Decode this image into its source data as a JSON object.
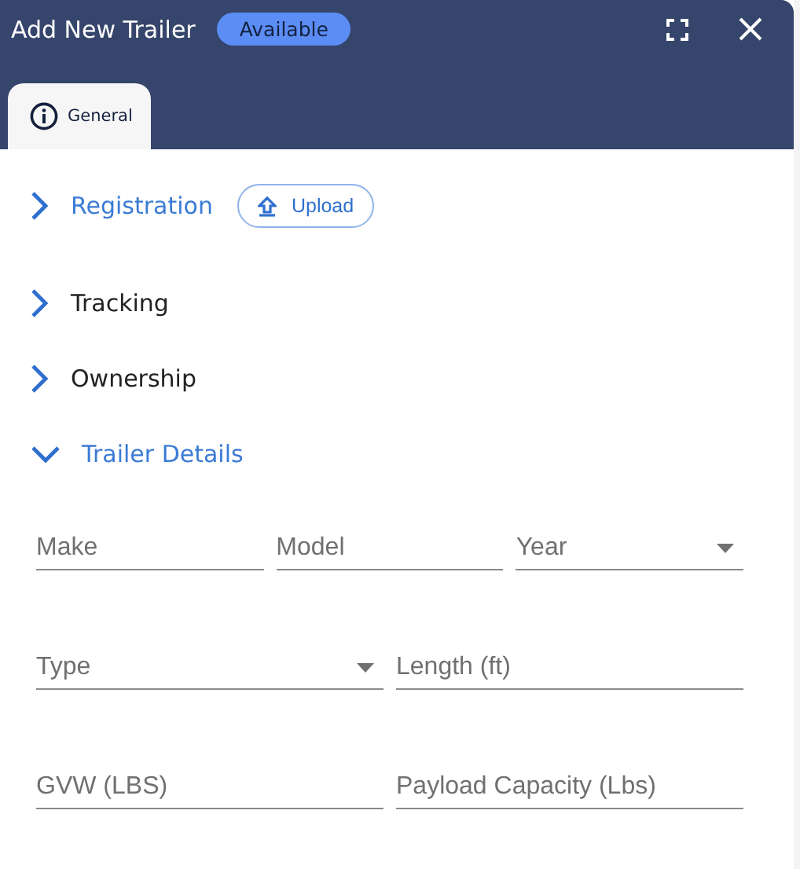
{
  "header": {
    "title": "Add New Trailer",
    "status": "Available"
  },
  "tabs": [
    {
      "label": "General",
      "selected": true
    }
  ],
  "sections": [
    {
      "title": "Registration",
      "expanded": false,
      "highlighted": true,
      "action": "Upload"
    },
    {
      "title": "Tracking",
      "expanded": false,
      "highlighted": false
    },
    {
      "title": "Ownership",
      "expanded": false,
      "highlighted": false
    },
    {
      "title": "Trailer Details",
      "expanded": true,
      "highlighted": true
    }
  ],
  "field_rows": [
    [
      {
        "placeholder": "Make",
        "kind": "text"
      },
      {
        "placeholder": "Model",
        "kind": "text"
      },
      {
        "placeholder": "Year",
        "kind": "select"
      }
    ],
    [
      {
        "placeholder": "Type",
        "kind": "select"
      },
      {
        "placeholder": "Length (ft)",
        "kind": "text"
      }
    ],
    [
      {
        "placeholder": "GVW (LBS)",
        "kind": "text"
      },
      {
        "placeholder": "Payload Capacity (Lbs)",
        "kind": "text"
      }
    ]
  ]
}
